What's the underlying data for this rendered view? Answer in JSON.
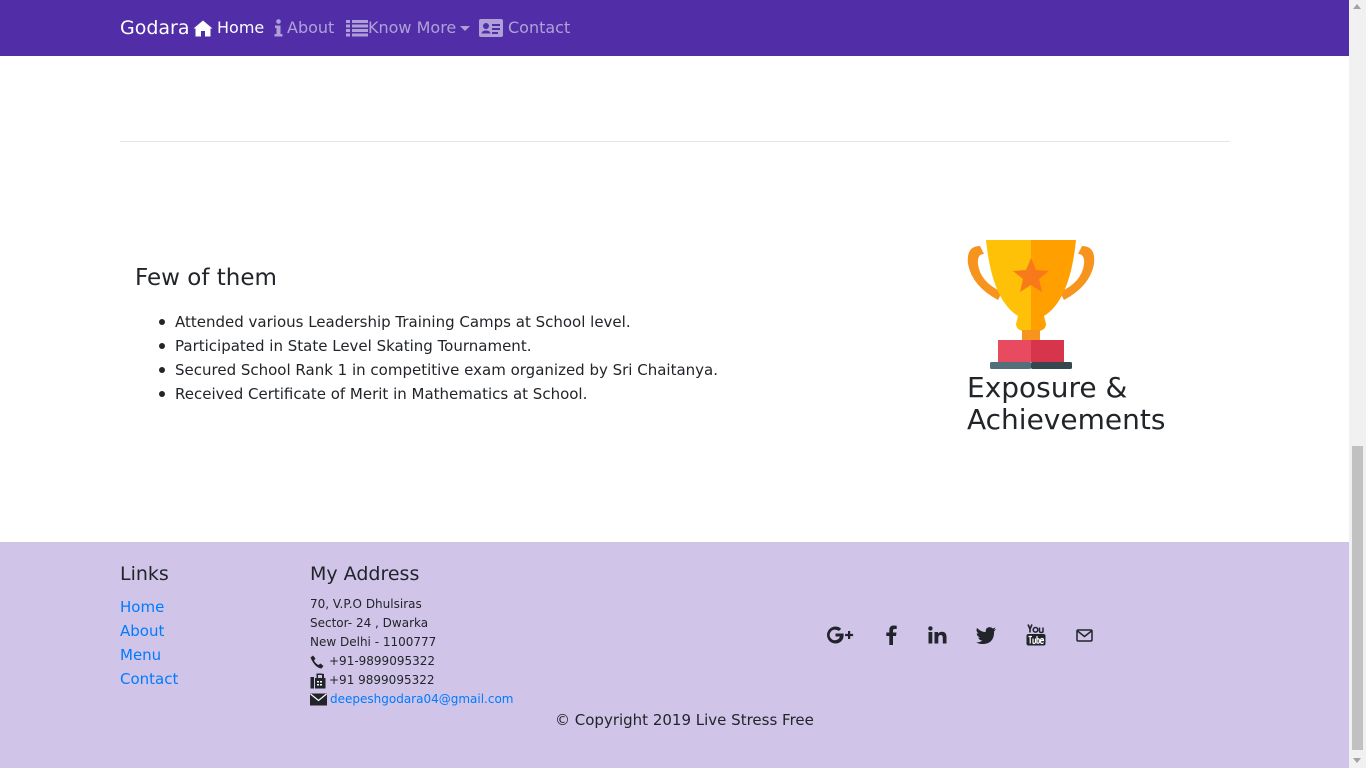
{
  "navbar": {
    "brand": "Godara",
    "items": [
      {
        "label": "Home",
        "icon": "home-icon",
        "active": true
      },
      {
        "label": "About",
        "icon": "info-icon"
      },
      {
        "label": "Know More",
        "icon": "list-icon",
        "dropdown": true
      },
      {
        "label": "Contact",
        "icon": "address-card-icon"
      }
    ],
    "bg_color": "#512DA8"
  },
  "main": {
    "section_title": "Few of them",
    "achievements": [
      "Attended various Leadership Training Camps at School level.",
      "Participated in State Level Skating Tournament.",
      "Secured School Rank 1 in competitive exam organized by Sri Chaitanya.",
      "Received Certificate of Merit in Mathematics at School."
    ],
    "trophy_title": "Exposure & Achievements",
    "trophy_icon": "trophy-icon"
  },
  "footer": {
    "bg_color": "#D1C4E9",
    "links_heading": "Links",
    "links": [
      "Home",
      "About",
      "Menu",
      "Contact"
    ],
    "address_heading": "My Address",
    "address_lines": [
      "70, V.P.O Dhulsiras",
      "Sector- 24 , Dwarka",
      "New Delhi - 1100777"
    ],
    "phone": "+91-9899095322",
    "fax": "+91 9899095322",
    "email": "deepeshgodara04@gmail.com",
    "social": [
      "google-plus-icon",
      "facebook-icon",
      "linkedin-icon",
      "twitter-icon",
      "youtube-icon",
      "mail-icon"
    ],
    "copyright": "© Copyright 2019 Live Stress Free"
  }
}
